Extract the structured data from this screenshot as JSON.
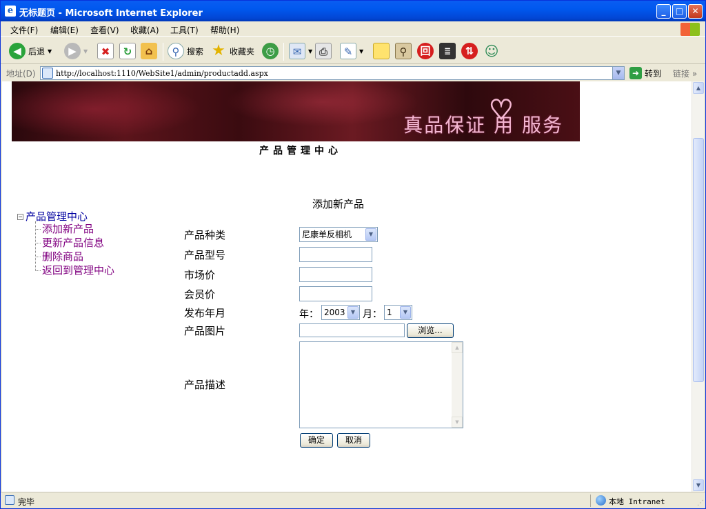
{
  "window": {
    "title": "无标题页 - Microsoft Internet Explorer"
  },
  "menu": [
    "文件(F)",
    "编辑(E)",
    "查看(V)",
    "收藏(A)",
    "工具(T)",
    "帮助(H)"
  ],
  "toolbar": {
    "back": "后退",
    "search": "搜索",
    "favorites": "收藏夹"
  },
  "address": {
    "label": "地址(D)",
    "url": "http://localhost:1110/WebSite1/admin/productadd.aspx",
    "go": "转到",
    "links": "链接"
  },
  "banner": {
    "slogan": "真品保证 用  服务"
  },
  "page": {
    "title": "产品管理中心"
  },
  "tree": {
    "root": "产品管理中心",
    "items": [
      "添加新产品",
      "更新产品信息",
      "删除商品",
      "返回到管理中心"
    ]
  },
  "form": {
    "title": "添加新产品",
    "labels": [
      "产品种类",
      "产品型号",
      "市场价",
      "会员价",
      "发布年月",
      "产品图片",
      "产品描述"
    ],
    "category_value": "尼康单反相机",
    "year_label": "年：",
    "year_value": "2003",
    "month_label": "月：",
    "month_value": "1",
    "browse": "浏览...",
    "ok": "确定",
    "cancel": "取消"
  },
  "status": {
    "text": "完毕",
    "zone": "本地 Intranet"
  },
  "colors": {
    "titlebar": "#0058ee",
    "tree_root": "#0000a0",
    "tree_item": "#800080"
  }
}
